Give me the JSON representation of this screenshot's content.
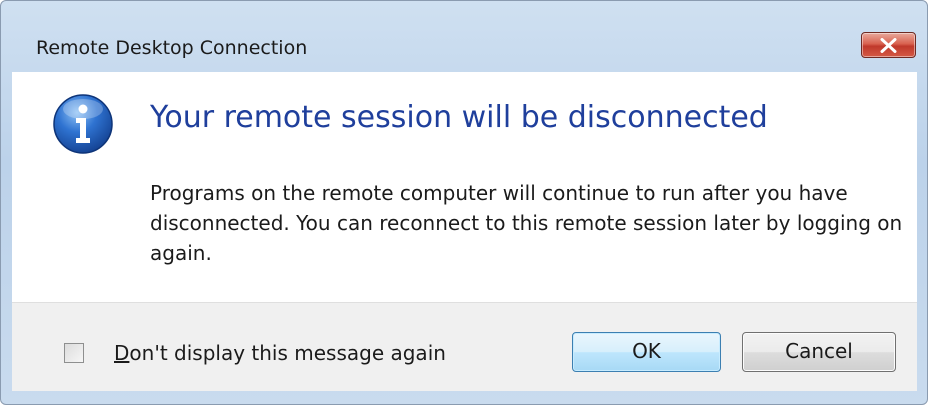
{
  "window": {
    "title": "Remote Desktop Connection"
  },
  "message": {
    "icon": "info-icon",
    "heading": "Your remote session will be disconnected",
    "body": "Programs on the remote computer will continue to run after you have disconnected. You can reconnect to this remote session later by logging on again."
  },
  "footer": {
    "checkbox_mnemonic": "D",
    "checkbox_label_rest": "on't display this message again",
    "checkbox_checked": false,
    "ok_label": "OK",
    "cancel_label": "Cancel"
  },
  "colors": {
    "heading": "#1f3f9c",
    "close_button": "#c0392b",
    "ok_button_border": "#3c7fb1"
  }
}
